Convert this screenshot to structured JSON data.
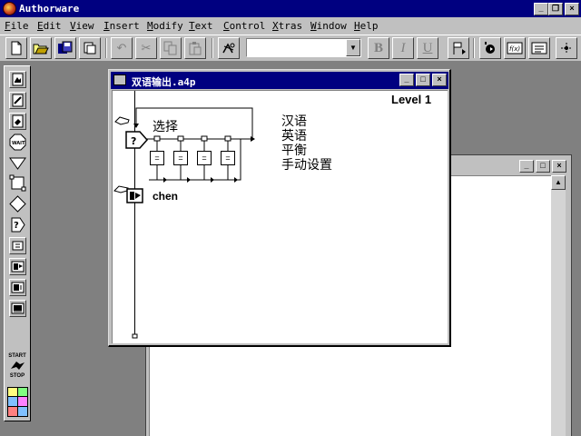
{
  "app": {
    "title": "Authorware",
    "icon": "authorware-logo-icon"
  },
  "menu": [
    "File",
    "Edit",
    "View",
    "Insert",
    "Modify",
    "Text",
    "Control",
    "Xtras",
    "Window",
    "Help"
  ],
  "toolbar": {
    "buttons": [
      "new-file-icon",
      "open-file-icon",
      "save-all-icon",
      "import-icon",
      "undo-icon",
      "cut-icon",
      "copy-icon",
      "paste-icon",
      "find-icon"
    ],
    "font_select_value": "",
    "style_buttons": [
      "B",
      "I",
      "U"
    ],
    "right_buttons": [
      "run-flag-icon",
      "control-panel-icon",
      "functions-icon",
      "variables-icon",
      "knowledge-objects-icon"
    ]
  },
  "palette": {
    "icons": [
      "display-icon",
      "animation-icon",
      "erase-icon",
      "wait-icon",
      "navigate-icon",
      "framework-icon",
      "decision-icon",
      "interaction-icon",
      "calculation-icon",
      "digital-movie-icon",
      "sound-icon",
      "video-icon"
    ],
    "wait_label": "WAIT",
    "start_label": "START",
    "stop_label": "STOP"
  },
  "flowline_window": {
    "title": "双语输出.a4p",
    "level": "Level 1",
    "interaction_label": "选择",
    "responses": [
      "汉语",
      "英语",
      "平衡",
      "手动设置"
    ],
    "response_icon_mark": "=",
    "movie_label": "chen"
  }
}
